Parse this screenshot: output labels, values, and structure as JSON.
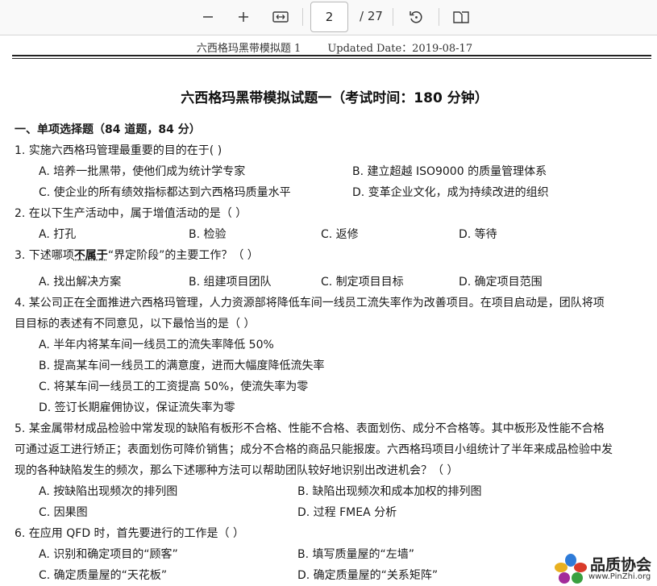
{
  "toolbar": {
    "zoom_out_icon": "minus-icon",
    "zoom_in_icon": "plus-icon",
    "fit_icon": "fit-width-icon",
    "page_current": "2",
    "page_total": "/ 27",
    "rotate_icon": "rotate-icon",
    "view_icon": "two-page-view-icon"
  },
  "header": {
    "running_head": "六西格玛黑带模拟题 1        Updated Date：2019-08-17"
  },
  "document": {
    "title": "六西格玛黑带模拟试题一（考试时间：180 分钟）",
    "section": "一、单项选择题（84 道题，84 分）",
    "questions": {
      "q1": {
        "text": "1. 实施六西格玛管理最重要的目的在于(        )",
        "a": "A. 培养一批黑带，使他们成为统计学专家",
        "b": "B. 建立超越 ISO9000 的质量管理体系",
        "c": "C. 使企业的所有绩效指标都达到六西格玛质量水平",
        "d": "D. 变革企业文化，成为持续改进的组织"
      },
      "q2": {
        "text": "2. 在以下生产活动中，属于增值活动的是（         ）",
        "a": "A. 打孔",
        "b": "B. 检验",
        "c": "C. 返修",
        "d": "D. 等待"
      },
      "q3": {
        "pre": "3. 下述哪项",
        "emph": "不属于",
        "post": "“界定阶段”的主要工作？（          ）",
        "a": "A. 找出解决方案",
        "b": "B. 组建项目团队",
        "c": "C. 制定项目目标",
        "d": "D. 确定项目范围"
      },
      "q4": {
        "line1": "4. 某公司正在全面推进六西格玛管理，人力资源部将降低车间一线员工流失率作为改善项目。在项目启动是，团队将项",
        "line2": "目目标的表述有不同意见，以下最恰当的是（          ）",
        "a": "A. 半年内将某车间一线员工的流失率降低  50%",
        "b": "B. 提高某车间一线员工的满意度，进而大幅度降低流失率",
        "c": "C. 将某车间一线员工的工资提高  50%，使流失率为零",
        "d": "D. 签订长期雇佣协议，保证流失率为零"
      },
      "q5": {
        "line1": "5. 某金属带材成品检验中常发现的缺陷有板形不合格、性能不合格、表面划伤、成分不合格等。其中板形及性能不合格",
        "line2": "可通过返工进行矫正；表面划伤可降价销售；成分不合格的商品只能报废。六西格玛项目小组统计了半年来成品检验中发",
        "line3": "现的各种缺陷发生的频次，那么下述哪种方法可以帮助团队较好地识别出改进机会？（          ）",
        "a": "A. 按缺陷出现频次的排列图",
        "b": "B. 缺陷出现频次和成本加权的排列图",
        "c": "C. 因果图",
        "d": "D. 过程 FMEA 分析"
      },
      "q6": {
        "text": "6. 在应用 QFD 时，首先要进行的工作是（            ）",
        "a": "A. 识别和确定项目的“顾客”",
        "b": "B. 填写质量屋的“左墙”",
        "c": "C. 确定质量屋的“天花板”",
        "d": "D. 确定质量屋的“关系矩阵”"
      }
    }
  },
  "watermark": {
    "name": "品质协会",
    "url": "www.PinZhi.org"
  }
}
